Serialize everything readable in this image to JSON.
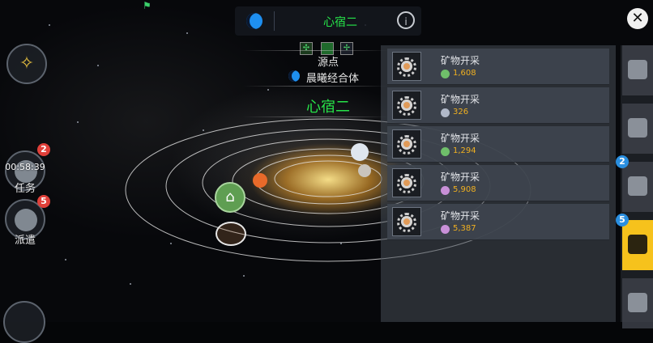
{
  "top_bar": {
    "faction_icon": "faction-c-icon",
    "system_title": "心宿二",
    "info_label": "i"
  },
  "close_label": "✕",
  "left_sidebar": {
    "starmap_icon": "constellation-icon",
    "task": {
      "timer": "00:58:39",
      "label": "任务",
      "badge": "2"
    },
    "dispatch": {
      "label": "派遣",
      "badge": "5"
    }
  },
  "system_info": {
    "origin_label": "源点",
    "corp_name": "晨曦经合体",
    "system_name": "心宿二"
  },
  "mining_list": [
    {
      "title": "矿物开采",
      "amount": "1,608",
      "resource_color": "#6fbf6a"
    },
    {
      "title": "矿物开采",
      "amount": "326",
      "resource_color": "#b0b8c8"
    },
    {
      "title": "矿物开采",
      "amount": "1,294",
      "resource_color": "#6fbf6a"
    },
    {
      "title": "矿物开采",
      "amount": "5,908",
      "resource_color": "#c890d8"
    },
    {
      "title": "矿物开采",
      "amount": "5,387",
      "resource_color": "#c890d8"
    }
  ],
  "right_tabs": [
    {
      "name": "planet-tab",
      "icon": "planet-icon",
      "active": false
    },
    {
      "name": "document-tab",
      "icon": "document-icon",
      "active": false
    },
    {
      "name": "card-tab",
      "icon": "card-icon",
      "badge": "2",
      "active": false
    },
    {
      "name": "fleet-tab",
      "icon": "fleet-icon",
      "badge": "5",
      "active": true
    },
    {
      "name": "misc-tab",
      "icon": "misc-icon",
      "active": false
    }
  ],
  "colors": {
    "system_name_green": "#27e449",
    "amount_orange": "#f0b020",
    "badge_red": "#e0403a",
    "badge_blue": "#2a8fe0",
    "active_tab_yellow": "#f6c21c"
  }
}
